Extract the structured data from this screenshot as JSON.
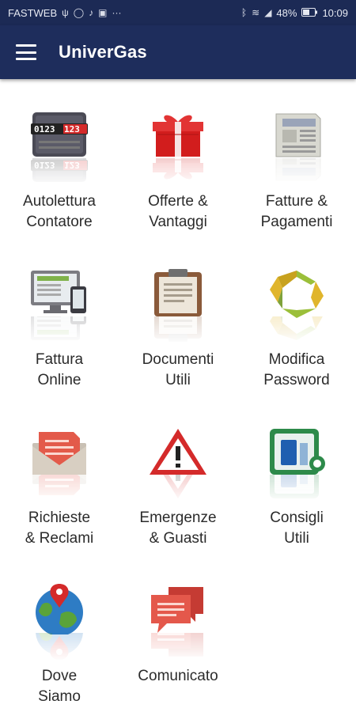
{
  "status_bar": {
    "carrier": "FASTWEB",
    "left_icons": [
      "usb-icon",
      "whatsapp-icon",
      "tiktok-icon",
      "gallery-icon",
      "more-icon"
    ],
    "right_icons": [
      "bluetooth-icon",
      "wifi-icon",
      "signal-icon"
    ],
    "battery": "48%",
    "time": "10:09"
  },
  "app_bar": {
    "title": "UniverGas",
    "menu_icon": "hamburger-menu-icon",
    "background": "#1e2d5c"
  },
  "tiles": [
    {
      "id": "autolettura",
      "label": "Autolettura\nContatore",
      "icon": "meter-icon",
      "meter_digits": "0123123"
    },
    {
      "id": "offerte",
      "label": "Offerte &\nVantaggi",
      "icon": "gift-icon"
    },
    {
      "id": "fatture",
      "label": "Fatture &\nPagamenti",
      "icon": "newspaper-icon"
    },
    {
      "id": "fattura-online",
      "label": "Fattura\nOnline",
      "icon": "monitor-phone-icon"
    },
    {
      "id": "documenti",
      "label": "Documenti\nUtili",
      "icon": "clipboard-icon"
    },
    {
      "id": "password",
      "label": "Modifica\nPassword",
      "icon": "refresh-arrows-icon"
    },
    {
      "id": "richieste",
      "label": "Richieste\n& Reclami",
      "icon": "envelope-icon"
    },
    {
      "id": "emergenze",
      "label": "Emergenze\n& Guasti",
      "icon": "warning-icon"
    },
    {
      "id": "consigli",
      "label": "Consigli\nUtili",
      "icon": "gas-tips-icon"
    },
    {
      "id": "dove",
      "label": "Dove\nSiamo",
      "icon": "globe-pin-icon"
    },
    {
      "id": "comunicato",
      "label": "Comunicato",
      "icon": "chat-bubbles-icon"
    }
  ]
}
